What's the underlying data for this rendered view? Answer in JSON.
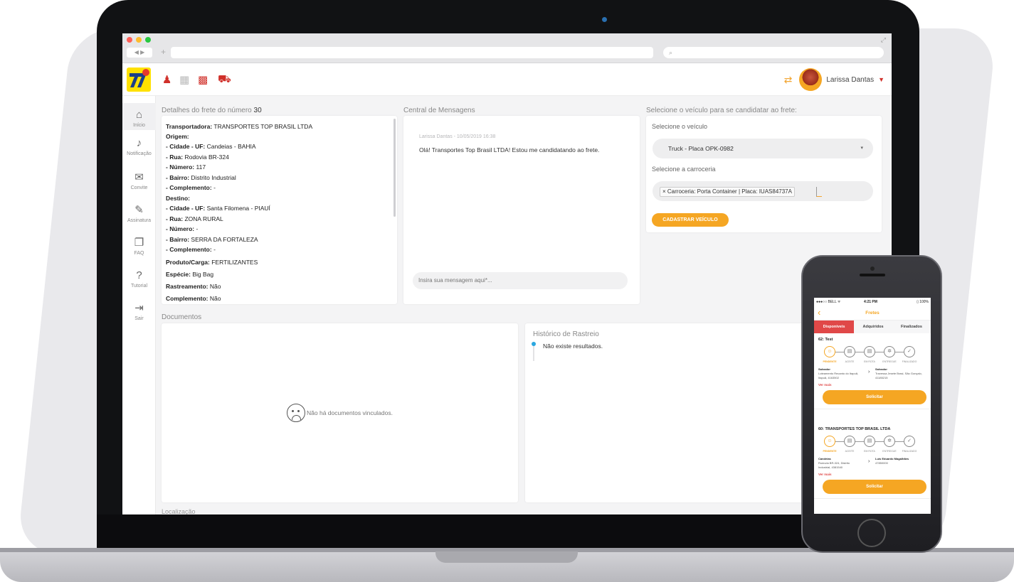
{
  "app": {
    "user_name": "Larissa Dantas",
    "colors": {
      "accent": "#f5a623",
      "brand_yellow": "#ffe100",
      "brand_red": "#d0302a",
      "timeline_blue": "#2aa7e0"
    }
  },
  "browser": {
    "search_icon": "search-icon",
    "nav": "◀ ▶",
    "new_tab": "+"
  },
  "header": {
    "icons": [
      "user-icon",
      "building-icon",
      "factory-icon",
      "truck-icon"
    ],
    "swap_icon": "swap-arrows-icon",
    "user_name": "Larissa Dantas"
  },
  "sidebar": {
    "items": [
      {
        "label": "Início",
        "icon": "home-icon"
      },
      {
        "label": "Notificação",
        "icon": "bell-icon"
      },
      {
        "label": "Convite",
        "icon": "envelope-icon"
      },
      {
        "label": "Assinatura",
        "icon": "signature-icon"
      },
      {
        "label": "FAQ",
        "icon": "faq-icon"
      },
      {
        "label": "Tutorial",
        "icon": "help-icon"
      },
      {
        "label": "Sair",
        "icon": "logout-icon"
      }
    ]
  },
  "details": {
    "title_prefix": "Detalhes do frete do número",
    "number": "30",
    "rows": [
      {
        "k": "Transportadora:",
        "v": " TRANSPORTES TOP BRASIL LTDA"
      },
      {
        "k": "Origem:",
        "v": ""
      },
      {
        "k": " - Cidade - UF:",
        "v": " Candeias - BAHIA"
      },
      {
        "k": " - Rua:",
        "v": " Rodovia BR-324"
      },
      {
        "k": " - Número:",
        "v": " 117"
      },
      {
        "k": " - Bairro:",
        "v": " Distrito Industrial"
      },
      {
        "k": " - Complemento:",
        "v": " -"
      },
      {
        "k": "Destino:",
        "v": ""
      },
      {
        "k": " - Cidade - UF:",
        "v": " Santa Filomena - PIAUÍ"
      },
      {
        "k": " - Rua:",
        "v": " ZONA RURAL"
      },
      {
        "k": " - Número:",
        "v": " -"
      },
      {
        "k": " - Bairro:",
        "v": " SERRA DA FORTALEZA"
      },
      {
        "k": " - Complemento:",
        "v": " -"
      },
      {
        "k": "Produto/Carga:",
        "v": " FERTILIZANTES"
      },
      {
        "k": "Espécie:",
        "v": " Big Bag"
      },
      {
        "k": "Rastreamento:",
        "v": " Não"
      },
      {
        "k": "Complemento:",
        "v": " Não"
      }
    ]
  },
  "messages": {
    "title": "Central de Mensagens",
    "meta": "Larissa Dantas - 10/05/2019 16:38",
    "text": "Olá! Transportes Top Brasil LTDA! Estou me candidatando ao frete.",
    "input_placeholder": "Insira sua mensagem aqui*..."
  },
  "vehicle": {
    "title": "Selecione o veículo para se candidatar ao frete:",
    "vehicle_label": "Selecione o veículo",
    "vehicle_value": "Truck - Placa OPK-0982",
    "body_label": "Selecione a carroceria",
    "body_chip": "× Carroceria: Porta Container | Placa: IUAS84737A",
    "register_button": "CADASTRAR VEÍCULO"
  },
  "documents": {
    "title": "Documentos",
    "empty": "Não há documentos vinculados."
  },
  "history": {
    "title": "Histórico de Rastreio",
    "empty": "Não existe resultados."
  },
  "bottom_label": "Localização",
  "phone": {
    "status_left": "●●●○○ BELL ᯤ",
    "status_time": "4:21 PM",
    "status_right": "▯ 100%",
    "back": "‹",
    "title": "Fretes",
    "tabs": [
      "Disponíveis",
      "Adquiridos",
      "Finalizados"
    ],
    "steps": [
      "PENDENTE",
      "ACEITE",
      "EM ROTA",
      "ENTREGUE",
      "FINALIZADO"
    ],
    "cards": [
      {
        "title": "62: Test",
        "from_city": "Salvador",
        "from_addr": "Loteamento Recanto do Itapuã, Itapuã, 4163502",
        "to_city": "Salvador",
        "to_addr": "Travessa Jesete Brasi, São Gonçalo, 41185215",
        "more": "Ver mais",
        "button": "Solicitar"
      },
      {
        "title": "60: TRANSPORTES TOP BRASIL LTDA",
        "from_city": "Candeias",
        "from_addr": "Rodovia BR-324, Distrito Industrial, 4381540",
        "to_city": "Luís Eduardo Magalhães",
        "to_addr": "47850000",
        "more": "Ver mais",
        "button": "Solicitar"
      }
    ]
  }
}
